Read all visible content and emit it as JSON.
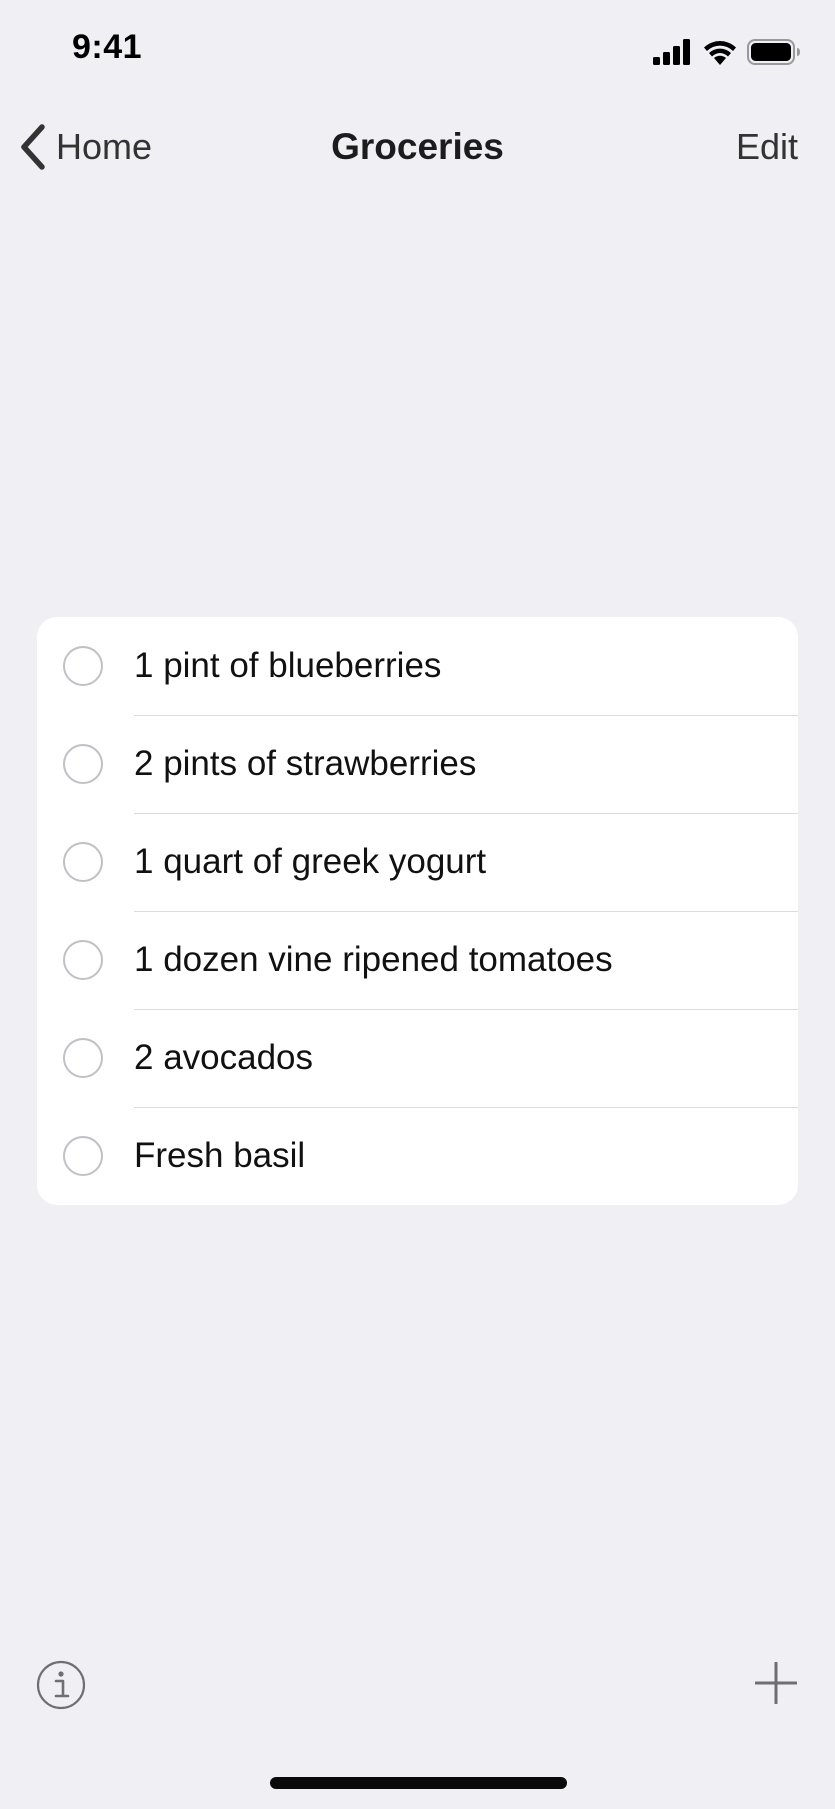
{
  "status_bar": {
    "time": "9:41",
    "signal_icon": "signal-bars-icon",
    "wifi_icon": "wifi-icon",
    "battery_icon": "battery-icon"
  },
  "nav": {
    "back_icon": "chevron-left-icon",
    "back_label": "Home",
    "title": "Groceries",
    "edit_label": "Edit"
  },
  "list": {
    "items": [
      {
        "label": "1 pint of blueberries",
        "checked": false
      },
      {
        "label": "2 pints of strawberries",
        "checked": false
      },
      {
        "label": "1 quart of greek yogurt",
        "checked": false
      },
      {
        "label": "1 dozen vine ripened tomatoes",
        "checked": false
      },
      {
        "label": "2 avocados",
        "checked": false
      },
      {
        "label": "Fresh basil",
        "checked": false
      }
    ]
  },
  "toolbar": {
    "info_icon": "info-icon",
    "add_icon": "plus-icon"
  },
  "colors": {
    "background": "#efeff4",
    "card": "#ffffff",
    "separator": "#dcdce0",
    "circle": "#c0c0c5",
    "text": "#111111",
    "secondary_text": "#333333"
  }
}
